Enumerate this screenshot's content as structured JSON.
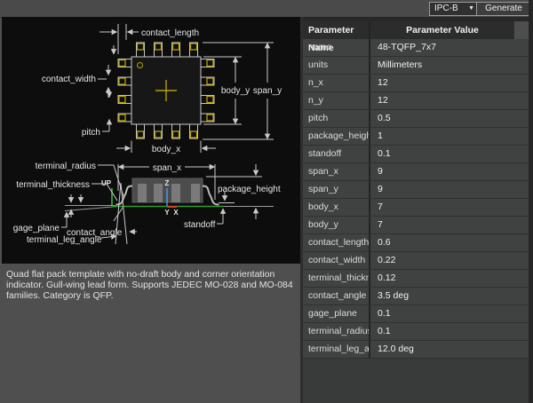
{
  "toolbar": {
    "preset_value": "IPC-B",
    "generate_label": "Generate"
  },
  "table": {
    "name_header": "Parameter Name",
    "value_header": "Parameter Value",
    "rows": [
      {
        "name": "name",
        "value": "48-TQFP_7x7"
      },
      {
        "name": "units",
        "value": "Millimeters"
      },
      {
        "name": "n_x",
        "value": "12"
      },
      {
        "name": "n_y",
        "value": "12"
      },
      {
        "name": "pitch",
        "value": "0.5"
      },
      {
        "name": "package_height",
        "value": "1"
      },
      {
        "name": "standoff",
        "value": "0.1"
      },
      {
        "name": "span_x",
        "value": "9"
      },
      {
        "name": "span_y",
        "value": "9"
      },
      {
        "name": "body_x",
        "value": "7"
      },
      {
        "name": "body_y",
        "value": "7"
      },
      {
        "name": "contact_length",
        "value": "0.6"
      },
      {
        "name": "contact_width",
        "value": "0.22"
      },
      {
        "name": "terminal_thickness",
        "value": "0.12"
      },
      {
        "name": "contact_angle",
        "value": "3.5 deg"
      },
      {
        "name": "gage_plane",
        "value": "0.1"
      },
      {
        "name": "terminal_radius",
        "value": "0.1"
      },
      {
        "name": "terminal_leg_angle",
        "value": "12.0 deg"
      }
    ]
  },
  "description": "Quad flat pack template with no-draft body and corner orientation indicator. Gull-wing lead form. Supports JEDEC MO-028 and MO-084 families. Category is QFP.",
  "diagram": {
    "labels": {
      "contact_length": "contact_length",
      "contact_width": "contact_width",
      "pitch": "pitch",
      "body_x": "body_x",
      "body_y": "body_y",
      "span_y": "span_y",
      "span_x": "span_x",
      "terminal_radius": "terminal_radius",
      "terminal_thickness": "terminal_thickness",
      "gage_plane": "gage_plane",
      "contact_angle": "contact_angle",
      "terminal_leg_angle": "terminal_leg_angle",
      "package_height": "package_height",
      "standoff": "standoff"
    },
    "axes": {
      "up": "UP",
      "x": "X",
      "y": "Y",
      "z": "Z"
    }
  },
  "colors": {
    "pad_yellow": "#b5a000",
    "dimension_gray": "#c9c9c9",
    "board_green": "#2e9b2e",
    "axis_z_blue": "#4f9fe8",
    "axis_x_red": "#c84422",
    "panel_black": "#0c0d0c",
    "app_gray": "#4f4f4f"
  }
}
